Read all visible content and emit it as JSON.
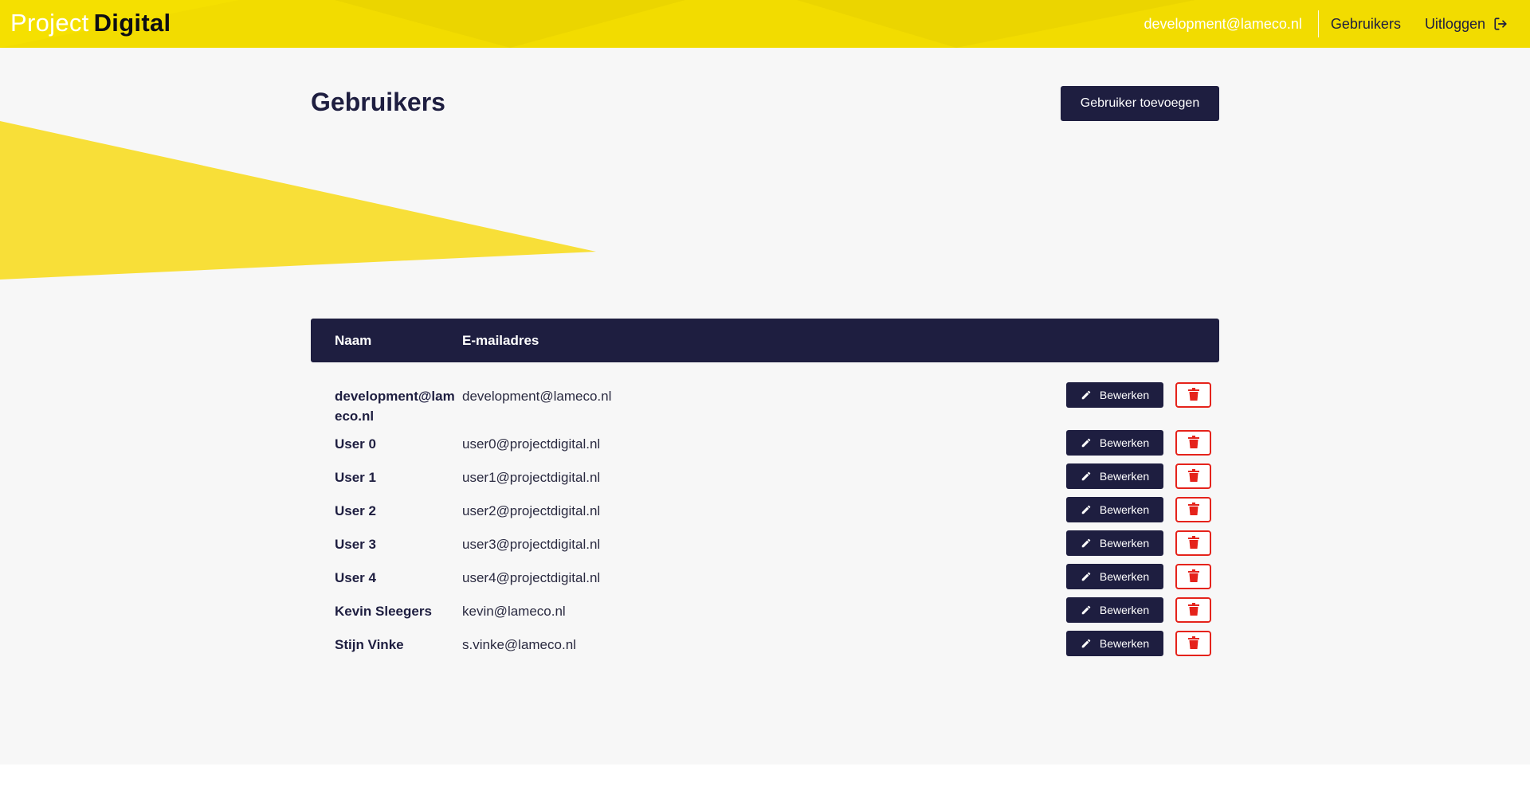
{
  "header": {
    "brand_light": "Project",
    "brand_bold": "Digital",
    "user_email": "development@lameco.nl",
    "nav_users": "Gebruikers",
    "nav_logout": "Uitloggen"
  },
  "page": {
    "title": "Gebruikers",
    "add_button": "Gebruiker toevoegen"
  },
  "table": {
    "columns": {
      "name": "Naam",
      "email": "E-mailadres"
    },
    "edit_label": "Bewerken",
    "rows": [
      {
        "name": "development@lameco.nl",
        "email": "development@lameco.nl"
      },
      {
        "name": "User 0",
        "email": "user0@projectdigital.nl"
      },
      {
        "name": "User 1",
        "email": "user1@projectdigital.nl"
      },
      {
        "name": "User 2",
        "email": "user2@projectdigital.nl"
      },
      {
        "name": "User 3",
        "email": "user3@projectdigital.nl"
      },
      {
        "name": "User 4",
        "email": "user4@projectdigital.nl"
      },
      {
        "name": "Kevin Sleegers",
        "email": "kevin@lameco.nl"
      },
      {
        "name": "Stijn Vinke",
        "email": "s.vinke@lameco.nl"
      }
    ]
  },
  "icons": {
    "logout": "logout-icon",
    "edit": "pencil-icon",
    "delete": "trash-icon"
  },
  "colors": {
    "brand_yellow": "#f2dc00",
    "navy": "#1e1e40",
    "danger": "#e5231b",
    "background": "#f7f7f7"
  }
}
